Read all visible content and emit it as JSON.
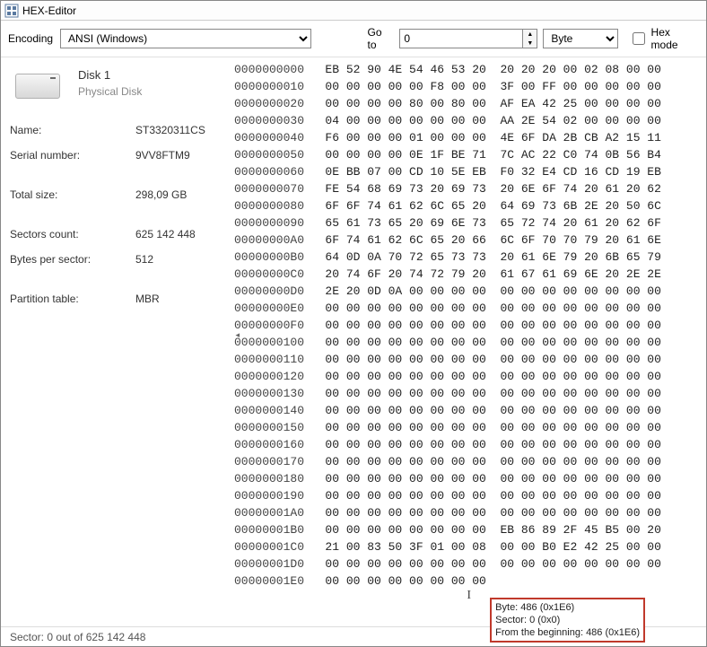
{
  "window": {
    "title": "HEX-Editor"
  },
  "toolbar": {
    "encoding_label": "Encoding",
    "encoding_value": "ANSI (Windows)",
    "goto_label": "Go to",
    "goto_value": "0",
    "unit_value": "Byte",
    "hexmode_label": "Hex mode"
  },
  "disk": {
    "title": "Disk 1",
    "subtitle": "Physical Disk",
    "props": {
      "name_label": "Name:",
      "name_value": "ST3320311CS",
      "serial_label": "Serial number:",
      "serial_value": "9VV8FTM9",
      "total_label": "Total size:",
      "total_value": "298,09 GB",
      "sectors_label": "Sectors count:",
      "sectors_value": "625 142 448",
      "bps_label": "Bytes per sector:",
      "bps_value": "512",
      "ptable_label": "Partition table:",
      "ptable_value": "MBR"
    }
  },
  "hex": {
    "rows": [
      {
        "off": "0000000000",
        "g1": "EB 52 90 4E 54 46 53 20",
        "g2": "20 20 20 00 02 08 00 00"
      },
      {
        "off": "0000000010",
        "g1": "00 00 00 00 00 F8 00 00",
        "g2": "3F 00 FF 00 00 00 00 00"
      },
      {
        "off": "0000000020",
        "g1": "00 00 00 00 80 00 80 00",
        "g2": "AF EA 42 25 00 00 00 00"
      },
      {
        "off": "0000000030",
        "g1": "04 00 00 00 00 00 00 00",
        "g2": "AA 2E 54 02 00 00 00 00"
      },
      {
        "off": "0000000040",
        "g1": "F6 00 00 00 01 00 00 00",
        "g2": "4E 6F DA 2B CB A2 15 11"
      },
      {
        "off": "0000000050",
        "g1": "00 00 00 00 0E 1F BE 71",
        "g2": "7C AC 22 C0 74 0B 56 B4"
      },
      {
        "off": "0000000060",
        "g1": "0E BB 07 00 CD 10 5E EB",
        "g2": "F0 32 E4 CD 16 CD 19 EB"
      },
      {
        "off": "0000000070",
        "g1": "FE 54 68 69 73 20 69 73",
        "g2": "20 6E 6F 74 20 61 20 62"
      },
      {
        "off": "0000000080",
        "g1": "6F 6F 74 61 62 6C 65 20",
        "g2": "64 69 73 6B 2E 20 50 6C"
      },
      {
        "off": "0000000090",
        "g1": "65 61 73 65 20 69 6E 73",
        "g2": "65 72 74 20 61 20 62 6F"
      },
      {
        "off": "00000000A0",
        "g1": "6F 74 61 62 6C 65 20 66",
        "g2": "6C 6F 70 70 79 20 61 6E"
      },
      {
        "off": "00000000B0",
        "g1": "64 0D 0A 70 72 65 73 73",
        "g2": "20 61 6E 79 20 6B 65 79"
      },
      {
        "off": "00000000C0",
        "g1": "20 74 6F 20 74 72 79 20",
        "g2": "61 67 61 69 6E 20 2E 2E"
      },
      {
        "off": "00000000D0",
        "g1": "2E 20 0D 0A 00 00 00 00",
        "g2": "00 00 00 00 00 00 00 00"
      },
      {
        "off": "00000000E0",
        "g1": "00 00 00 00 00 00 00 00",
        "g2": "00 00 00 00 00 00 00 00"
      },
      {
        "off": "00000000F0",
        "g1": "00 00 00 00 00 00 00 00",
        "g2": "00 00 00 00 00 00 00 00"
      },
      {
        "off": "0000000100",
        "g1": "00 00 00 00 00 00 00 00",
        "g2": "00 00 00 00 00 00 00 00"
      },
      {
        "off": "0000000110",
        "g1": "00 00 00 00 00 00 00 00",
        "g2": "00 00 00 00 00 00 00 00"
      },
      {
        "off": "0000000120",
        "g1": "00 00 00 00 00 00 00 00",
        "g2": "00 00 00 00 00 00 00 00"
      },
      {
        "off": "0000000130",
        "g1": "00 00 00 00 00 00 00 00",
        "g2": "00 00 00 00 00 00 00 00"
      },
      {
        "off": "0000000140",
        "g1": "00 00 00 00 00 00 00 00",
        "g2": "00 00 00 00 00 00 00 00"
      },
      {
        "off": "0000000150",
        "g1": "00 00 00 00 00 00 00 00",
        "g2": "00 00 00 00 00 00 00 00"
      },
      {
        "off": "0000000160",
        "g1": "00 00 00 00 00 00 00 00",
        "g2": "00 00 00 00 00 00 00 00"
      },
      {
        "off": "0000000170",
        "g1": "00 00 00 00 00 00 00 00",
        "g2": "00 00 00 00 00 00 00 00"
      },
      {
        "off": "0000000180",
        "g1": "00 00 00 00 00 00 00 00",
        "g2": "00 00 00 00 00 00 00 00"
      },
      {
        "off": "0000000190",
        "g1": "00 00 00 00 00 00 00 00",
        "g2": "00 00 00 00 00 00 00 00"
      },
      {
        "off": "00000001A0",
        "g1": "00 00 00 00 00 00 00 00",
        "g2": "00 00 00 00 00 00 00 00"
      },
      {
        "off": "00000001B0",
        "g1": "00 00 00 00 00 00 00 00",
        "g2": "EB 86 89 2F 45 B5 00 20"
      },
      {
        "off": "00000001C0",
        "g1": "21 00 83 50 3F 01 00 08",
        "g2": "00 00 B0 E2 42 25 00 00"
      },
      {
        "off": "00000001D0",
        "g1": "00 00 00 00 00 00 00 00",
        "g2": "00 00 00 00 00 00 00 00"
      },
      {
        "off": "00000001E0",
        "g1": "00 00 00 00 00 00 00 00",
        "g2": "                        "
      }
    ]
  },
  "tooltip": {
    "l1": "Byte: 486 (0x1E6)",
    "l2": "Sector: 0 (0x0)",
    "l3": "From the beginning: 486 (0x1E6)"
  },
  "status": {
    "text": "Sector: 0 out of 625 142 448"
  }
}
